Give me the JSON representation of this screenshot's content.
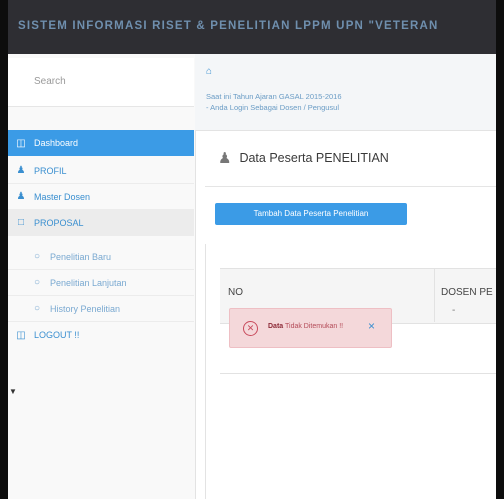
{
  "header": {
    "title": "SISTEM INFORMASI RISET & PENELITIAN LPPM UPN \"VETERAN"
  },
  "sidebar": {
    "search_placeholder": "Search",
    "items": [
      {
        "label": "Dashboard",
        "icon": "dashboard-icon",
        "active": true
      },
      {
        "label": "PROFIL",
        "icon": "user-icon"
      },
      {
        "label": "Master Dosen",
        "icon": "user-icon"
      },
      {
        "label": "PROPOSAL",
        "icon": "folder-icon"
      },
      {
        "label": "Penelitian Baru",
        "icon": "circle-icon",
        "sub": true
      },
      {
        "label": "Penelitian Lanjutan",
        "icon": "circle-icon",
        "sub": true
      },
      {
        "label": "History Penelitian",
        "icon": "circle-icon",
        "sub": true
      },
      {
        "label": "LOGOUT !!",
        "icon": "logout-icon"
      }
    ]
  },
  "breadcrumb": {
    "home_icon": "home-icon",
    "line1": "Saat ini Tahun Ajaran GASAL 2015-2016",
    "line2": "- Anda Login Sebagai Dosen / Pengusul"
  },
  "page": {
    "title": "Data Peserta PENELITIAN",
    "add_button": "Tambah Data Peserta Penelitian"
  },
  "table": {
    "columns": [
      "NO",
      "DOSEN PE"
    ],
    "cell_dash": "-"
  },
  "alert": {
    "bold": "Data",
    "text": " Tidak Ditemukan !!",
    "close": "×"
  },
  "colors": {
    "accent": "#3b9be6",
    "topbar": "#2e2e33",
    "alert_bg": "#f4d8da",
    "alert_text": "#b44b58"
  }
}
